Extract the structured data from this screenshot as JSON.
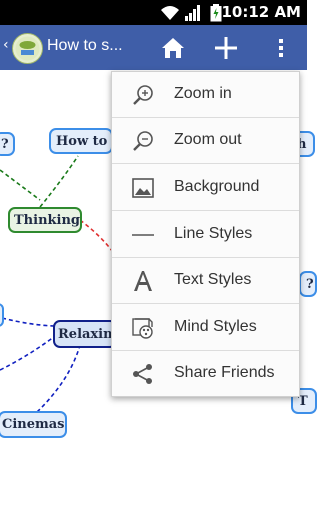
{
  "status_bar": {
    "time": "10:12 AM"
  },
  "action_bar": {
    "title": "How to s...",
    "back_glyph": "‹"
  },
  "mind_map": {
    "nodes": {
      "partial_left": "?",
      "how_to": "How to ?",
      "thinking": "Thinking",
      "relaxing": "Relaxing",
      "cinemas": "Cinemas",
      "partial_right_top": "h",
      "partial_right_mid": "?",
      "partial_right_bottom": "T"
    }
  },
  "overflow_menu": {
    "items": [
      {
        "label": "Zoom in",
        "icon": "zoom-in-icon"
      },
      {
        "label": "Zoom out",
        "icon": "zoom-out-icon"
      },
      {
        "label": "Background",
        "icon": "image-icon"
      },
      {
        "label": "Line Styles",
        "icon": "line-icon"
      },
      {
        "label": "Text Styles",
        "icon": "text-a-icon"
      },
      {
        "label": "Mind Styles",
        "icon": "palette-icon"
      },
      {
        "label": "Share Friends",
        "icon": "share-icon"
      }
    ]
  },
  "colors": {
    "action_bar": "#3f5ea8",
    "node_blue_border": "#3c8ee8",
    "node_green_border": "#2f8a2f",
    "node_navy_border": "#10208a",
    "link_green": "#1a7a1a",
    "link_red": "#e03030",
    "link_blue": "#1020c0"
  }
}
